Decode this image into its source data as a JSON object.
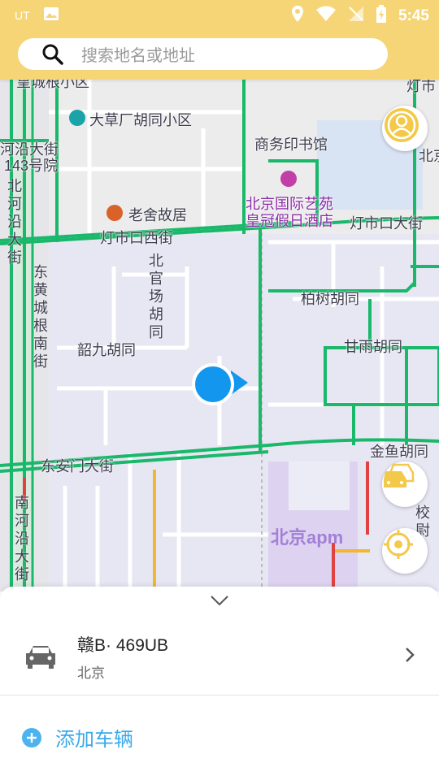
{
  "status_bar": {
    "carrier_label": "UT",
    "time": "5:45"
  },
  "search": {
    "placeholder": "搜索地名或地址"
  },
  "map": {
    "labels": {
      "top_left": "皇城根小区",
      "top_right": "灯市",
      "dacaochang": "大草厂胡同小区",
      "hyd_jie": "河沿大街",
      "no143": "143号院",
      "shangwu": "商务印书馆",
      "beijing_top": "北京",
      "laoshe": "老舍故居",
      "hotel_1": "北京国际艺苑",
      "hotel_2": "皇冠假日酒店",
      "dengshikou_xi": "灯市口西街",
      "dengshikou_da": "灯市口大街",
      "beihe": "北河沿大街",
      "donghuang": "东黄城根南街",
      "beiguan": "北官场胡同",
      "baishu": "柏树胡同",
      "shaojiu": "韶九胡同",
      "ganyu": "甘雨胡同",
      "jinyu": "金鱼胡同",
      "donganmen": "东安门大街",
      "nanhe": "南河沿大街",
      "xiaowei": "校尉",
      "apm": "北京apm"
    }
  },
  "vehicle": {
    "plate": "赣B· 469UB",
    "city": "北京"
  },
  "add_vehicle": {
    "label": "添加车辆"
  },
  "colors": {
    "header": "#f6d576",
    "accent": "#3aa9ea",
    "road_green": "#19b86a",
    "location": "#1296ee"
  }
}
